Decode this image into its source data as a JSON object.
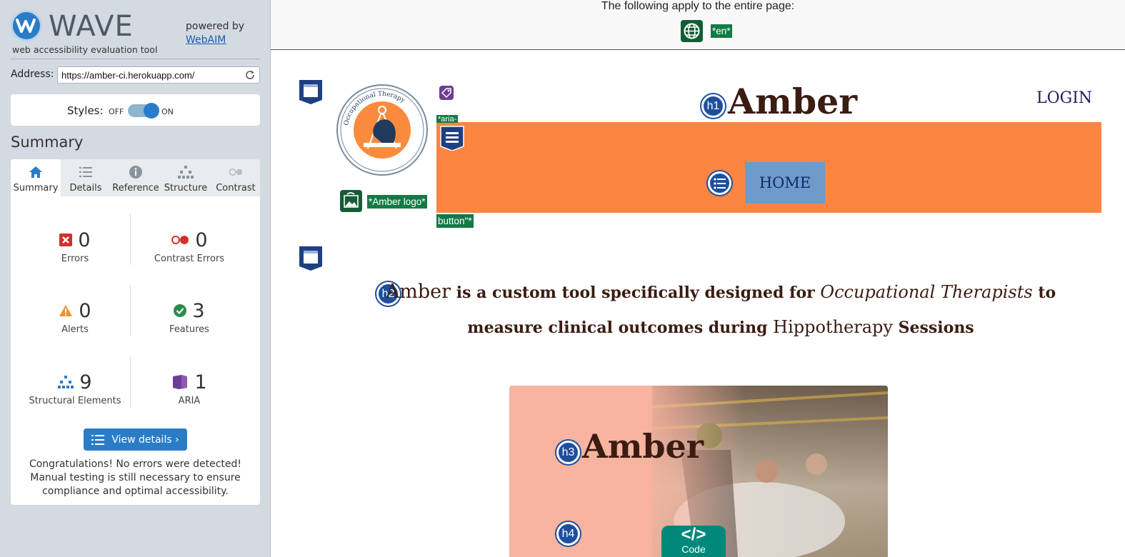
{
  "wave": {
    "title": "WAVE",
    "subtitle": "web accessibility evaluation tool",
    "powered_by": "powered by",
    "webaim": "WebAIM",
    "address_label": "Address:",
    "address_value": "https://amber-ci.herokuapp.com/",
    "styles_label": "Styles:",
    "styles_off": "OFF",
    "styles_on": "ON",
    "styles_state": "on",
    "summary_heading": "Summary",
    "tabs": [
      {
        "label": "Summary",
        "icon": "home-icon",
        "active": true
      },
      {
        "label": "Details",
        "icon": "list-icon",
        "active": false
      },
      {
        "label": "Reference",
        "icon": "info-icon",
        "active": false
      },
      {
        "label": "Structure",
        "icon": "structure-icon",
        "active": false
      },
      {
        "label": "Contrast",
        "icon": "contrast-icon",
        "active": false
      }
    ],
    "stats": [
      {
        "count": "0",
        "label": "Errors",
        "icon": "error-icon",
        "color": "#d0312d"
      },
      {
        "count": "0",
        "label": "Contrast Errors",
        "icon": "contrast-error-icon",
        "color": "#d0312d"
      },
      {
        "count": "0",
        "label": "Alerts",
        "icon": "alert-icon",
        "color": "#e8962a"
      },
      {
        "count": "3",
        "label": "Features",
        "icon": "feature-icon",
        "color": "#2e8a4e"
      },
      {
        "count": "9",
        "label": "Structural Elements",
        "icon": "structure-icon",
        "color": "#2a7cc7"
      },
      {
        "count": "1",
        "label": "ARIA",
        "icon": "aria-icon",
        "color": "#6d3d93"
      }
    ],
    "view_details": "View details ›",
    "congrats": "Congratulations! No errors were detected! Manual testing is still necessary to ensure compliance and optimal accessibility."
  },
  "page": {
    "apply_text": "The following apply to the entire page:",
    "lang_tag": "*en*",
    "aria_tag": "*aria-",
    "aria_tag_tail": "button\"*",
    "logo_alt_tag": "*Amber logo*",
    "logo_ring_text": "Occupational Therapy · Hippotherapy Measurement Tool",
    "site_title": "Amber",
    "login": "LOGIN",
    "home": "HOME",
    "h1": "h1",
    "h2": "h2",
    "h3": "h3",
    "h4": "h4",
    "intro": {
      "amber": "Amber",
      "part1": " is a custom tool specifically designed for ",
      "ot": "Occupational Therapists",
      "part2": " to measure clinical outcomes during ",
      "hippo": "Hippotherapy",
      "part3": " Sessions"
    },
    "hero_title": "Amber",
    "code_glyph": "</>",
    "code_label": "Code"
  },
  "colors": {
    "accent": "#2a7cc7",
    "nav_orange": "#fc8542",
    "home_button": "#6f9bca",
    "feature_green": "#137a45",
    "heading_blue": "#1e4f9c"
  }
}
